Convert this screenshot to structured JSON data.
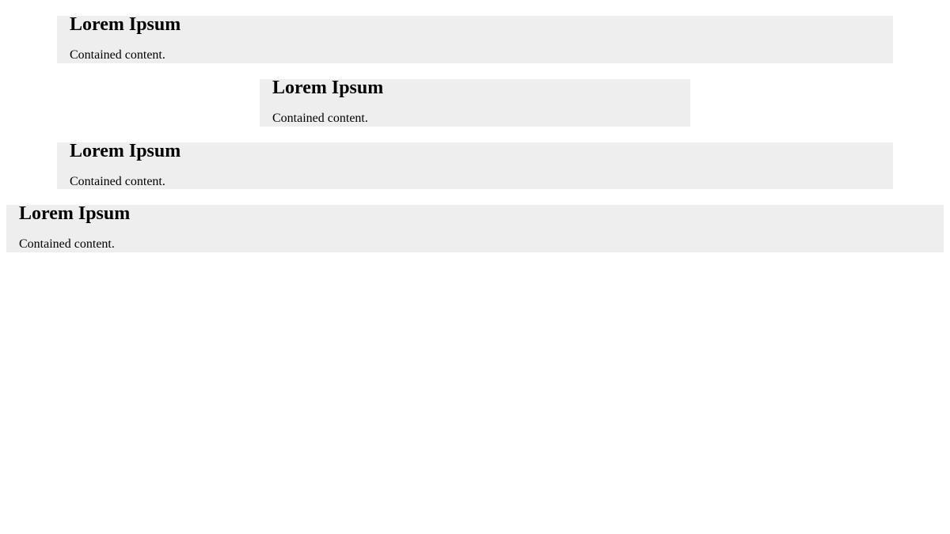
{
  "containers": [
    {
      "title": "Lorem Ipsum",
      "text": "Contained content."
    },
    {
      "title": "Lorem Ipsum",
      "text": "Contained content."
    },
    {
      "title": "Lorem Ipsum",
      "text": "Contained content."
    },
    {
      "title": "Lorem Ipsum",
      "text": "Contained content."
    }
  ],
  "colors": {
    "page_background": "#ffffff",
    "container_background": "#eeeeee",
    "text": "#000000"
  }
}
